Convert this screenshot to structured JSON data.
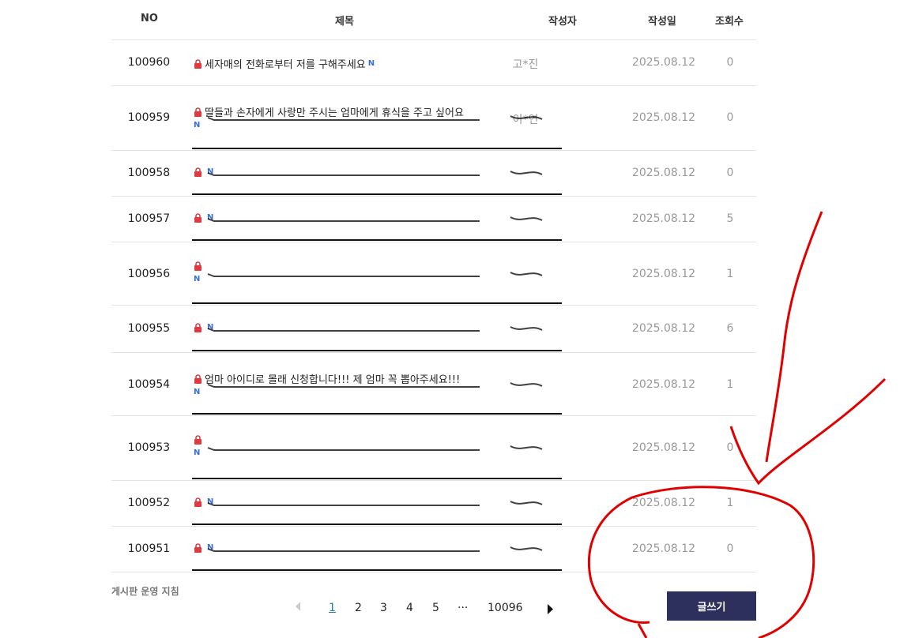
{
  "header": {
    "no": "NO",
    "title": "제목",
    "writer": "작성자",
    "date": "작성일",
    "views": "조회수"
  },
  "rows": [
    {
      "no": "100960",
      "title": "세자매의 전화로부터 저를 구해주세요",
      "writer": "고*진",
      "date": "2025.08.12",
      "views": "0"
    },
    {
      "no": "100959",
      "title": "딸들과 손자에게 사랑만 주시는 엄마에게 휴식을 주고 싶어요",
      "writer": "이*연",
      "date": "2025.08.12",
      "views": "0"
    },
    {
      "no": "100958",
      "title": "",
      "writer": "",
      "date": "2025.08.12",
      "views": "0"
    },
    {
      "no": "100957",
      "title": "",
      "writer": "",
      "date": "2025.08.12",
      "views": "5"
    },
    {
      "no": "100956",
      "title": "",
      "writer": "",
      "date": "2025.08.12",
      "views": "1"
    },
    {
      "no": "100955",
      "title": "",
      "writer": "",
      "date": "2025.08.12",
      "views": "6"
    },
    {
      "no": "100954",
      "title": "엄마 아이디로 몰래 신청합니다!!! 제 엄마 꼭 뽑아주세요!!!",
      "writer": "",
      "date": "2025.08.12",
      "views": "1"
    },
    {
      "no": "100953",
      "title": "",
      "writer": "",
      "date": "2025.08.12",
      "views": "0"
    },
    {
      "no": "100952",
      "title": "",
      "writer": "",
      "date": "2025.08.12",
      "views": "1"
    },
    {
      "no": "100951",
      "title": "",
      "writer": "",
      "date": "2025.08.12",
      "views": "0"
    }
  ],
  "badges": {
    "new": "N"
  },
  "icons": {
    "lock": "lock-icon",
    "next": "chevron-right-icon",
    "prev": "chevron-left-icon"
  },
  "footer": {
    "guide_link": "게시판 운영 지침"
  },
  "pagination": {
    "pages": [
      "1",
      "2",
      "3",
      "4",
      "5"
    ],
    "ellipsis": "···",
    "last": "10096",
    "current": "1"
  },
  "actions": {
    "write_label": "글쓰기"
  },
  "colors": {
    "lock": "#e0393e",
    "new_badge": "#3a6fd8",
    "write_button": "#2d2f5c",
    "annotation": "#e00000"
  }
}
